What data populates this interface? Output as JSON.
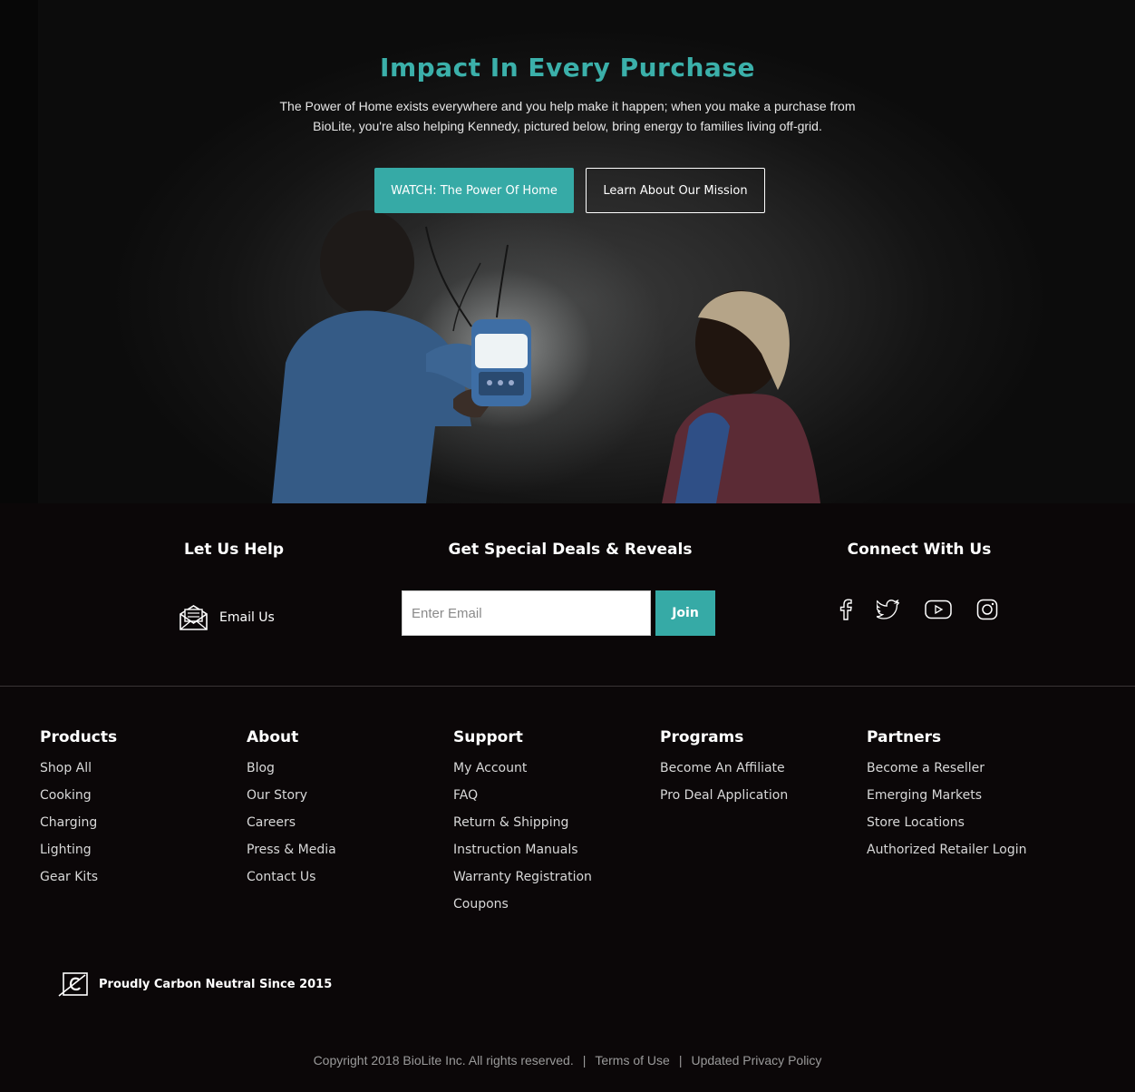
{
  "hero": {
    "title": "Impact In Every Purchase",
    "text": "The Power of Home exists everywhere and you help make it happen; when you make a purchase from BioLite, you're also helping Kennedy, pictured below, bring energy to families living off-grid.",
    "watch_button": "WATCH: The Power Of Home",
    "mission_button": "Learn About Our Mission"
  },
  "footer_top": {
    "help": {
      "heading": "Let Us Help",
      "email_label": "Email Us"
    },
    "deals": {
      "heading": "Get Special Deals & Reveals",
      "email_placeholder": "Enter Email",
      "join_label": "Join"
    },
    "connect": {
      "heading": "Connect With Us",
      "icons": [
        "facebook-icon",
        "twitter-icon",
        "youtube-icon",
        "instagram-icon"
      ]
    }
  },
  "columns": [
    {
      "heading": "Products",
      "links": [
        "Shop All",
        "Cooking",
        "Charging",
        "Lighting",
        "Gear Kits"
      ]
    },
    {
      "heading": "About",
      "links": [
        "Blog",
        "Our Story",
        "Careers",
        "Press & Media",
        "Contact Us"
      ]
    },
    {
      "heading": "Support",
      "links": [
        "My Account",
        "FAQ",
        "Return & Shipping",
        "Instruction Manuals",
        "Warranty Registration",
        "Coupons"
      ]
    },
    {
      "heading": "Programs",
      "links": [
        "Become An Affiliate",
        "Pro Deal Application"
      ]
    },
    {
      "heading": "Partners",
      "links": [
        "Become a Reseller",
        "Emerging Markets",
        "Store Locations",
        "Authorized Retailer Login"
      ]
    }
  ],
  "carbon": {
    "text": "Proudly Carbon Neutral Since 2015"
  },
  "legal": {
    "copyright": "Copyright 2018 BioLite Inc. All rights reserved.",
    "separator": "|",
    "terms": "Terms of Use",
    "privacy": "Updated Privacy Policy"
  },
  "colors": {
    "accent": "#36aaa6",
    "title": "#3bb0aa",
    "background": "#0b0708"
  }
}
